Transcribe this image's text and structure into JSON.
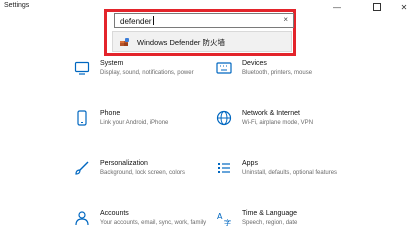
{
  "window": {
    "title": "Settings",
    "minimize": "—",
    "close": "✕"
  },
  "search": {
    "value": "defender",
    "clear": "×",
    "suggestion": "Windows Defender 防火墙"
  },
  "tiles": [
    {
      "name": "System",
      "desc": "Display, sound, notifications, power",
      "icon": "monitor-icon"
    },
    {
      "name": "Devices",
      "desc": "Bluetooth, printers, mouse",
      "icon": "keyboard-icon"
    },
    {
      "name": "Phone",
      "desc": "Link your Android, iPhone",
      "icon": "phone-icon"
    },
    {
      "name": "Network & Internet",
      "desc": "Wi-Fi, airplane mode, VPN",
      "icon": "globe-icon"
    },
    {
      "name": "Personalization",
      "desc": "Background, lock screen, colors",
      "icon": "brush-icon"
    },
    {
      "name": "Apps",
      "desc": "Uninstall, defaults, optional features",
      "icon": "apps-icon"
    },
    {
      "name": "Accounts",
      "desc": "Your accounts, email, sync, work, family",
      "icon": "person-icon"
    },
    {
      "name": "Time & Language",
      "desc": "Speech, region, date",
      "icon": "clock-language-icon"
    }
  ],
  "colors": {
    "accent": "#0067c0",
    "highlight": "#e3242b"
  }
}
